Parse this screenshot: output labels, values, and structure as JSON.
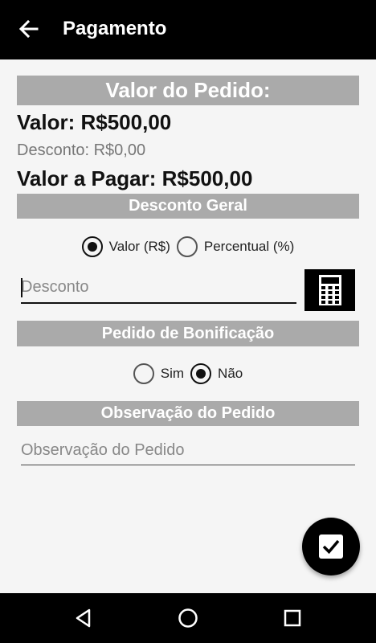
{
  "appbar": {
    "title": "Pagamento",
    "back_icon": "arrow-back-icon"
  },
  "order": {
    "heading": "Valor do Pedido:",
    "valor": "Valor: R$500,00",
    "desconto": "Desconto: R$0,00",
    "valor_pagar": "Valor a Pagar: R$500,00"
  },
  "desconto_geral": {
    "heading": "Desconto Geral",
    "options": [
      "Valor (R$)",
      "Percentual (%)"
    ],
    "selected": "Valor (R$)",
    "input_placeholder": "Desconto",
    "calculator_icon": "calculator-icon"
  },
  "bonificacao": {
    "heading": "Pedido de Bonificação",
    "options": [
      "Sim",
      "Não"
    ],
    "selected": "Não"
  },
  "observacao": {
    "heading": "Observação do Pedido",
    "input_placeholder": "Observação do Pedido"
  },
  "fab": {
    "icon": "check-box-icon"
  },
  "nav": {
    "back": "nav-back-icon",
    "home": "nav-home-icon",
    "recents": "nav-recents-icon"
  }
}
